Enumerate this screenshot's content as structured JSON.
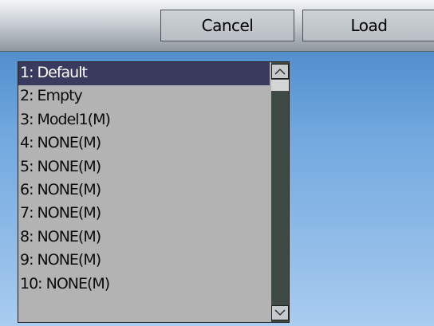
{
  "toolbar": {
    "cancel_label": "Cancel",
    "load_label": "Load"
  },
  "list": {
    "selected_index": 0,
    "items": [
      {
        "label": "1: Default"
      },
      {
        "label": "2: Empty"
      },
      {
        "label": "3: Model1(M)"
      },
      {
        "label": "4: NONE(M)"
      },
      {
        "label": "5: NONE(M)"
      },
      {
        "label": "6: NONE(M)"
      },
      {
        "label": "7: NONE(M)"
      },
      {
        "label": "8: NONE(M)"
      },
      {
        "label": "9: NONE(M)"
      },
      {
        "label": "10: NONE(M)"
      }
    ]
  },
  "scrollbar": {
    "up_icon": "chevron-up-icon",
    "down_icon": "chevron-down-icon"
  },
  "colors": {
    "selection": "#3a3a5e",
    "list_background": "#b3b3b3",
    "scroll_track": "#404a44"
  }
}
